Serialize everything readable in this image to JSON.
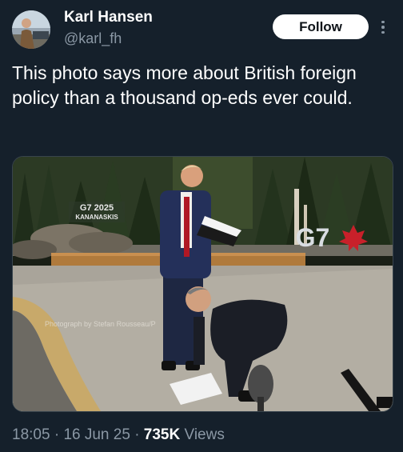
{
  "author": {
    "display_name": "Karl Hansen",
    "handle": "@karl_fh",
    "avatar_icon": "profile-photo"
  },
  "follow_button": {
    "label": "Follow"
  },
  "more_button": {
    "icon": "more-vertical-icon"
  },
  "tweet": {
    "text": "This photo says more about British foreign policy than a thousand op-eds ever could."
  },
  "media": {
    "sign_text_line1": "G7 2025",
    "sign_text_line2": "KANANASKIS",
    "g7_logo_text": "G7",
    "watermark": "Photograph by Stefan Rousseau/P"
  },
  "meta": {
    "time": "18:05",
    "separator1": "·",
    "date": "16 Jun 25",
    "separator2": "·",
    "views_count": "735K",
    "views_label": "Views"
  },
  "colors": {
    "background": "#15202b",
    "text_primary": "#ffffff",
    "text_secondary": "#8b98a5",
    "follow_bg": "#ffffff"
  }
}
